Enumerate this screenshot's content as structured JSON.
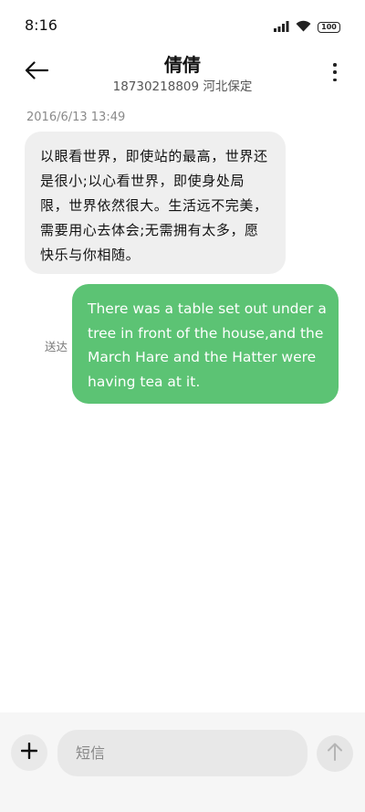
{
  "status_bar": {
    "time": "8:16",
    "battery": "100",
    "icons": [
      "signal-icon",
      "wifi-icon",
      "battery-icon"
    ]
  },
  "header": {
    "contact_name": "倩倩",
    "contact_subtitle": "18730218809 河北保定",
    "icons": [
      "back-arrow-icon",
      "more-options-icon"
    ]
  },
  "conversation": {
    "timestamp": "2016/6/13 13:49",
    "incoming_message": "以眼看世界，即使站的最高，世界还是很小;以心看世界，即使身处局限，世界依然很大。生活远不完美，需要用心去体会;无需拥有太多，愿快乐与你相随。",
    "outgoing_message": "There was a table set out under a tree in front of the house,and the March Hare and the Hatter were having tea at it.",
    "delivery_status": "送达"
  },
  "composer": {
    "placeholder": "短信",
    "value": "",
    "icons": [
      "plus-icon",
      "send-arrow-icon"
    ]
  },
  "colors": {
    "outgoing_bubble": "#5cc374",
    "incoming_bubble": "#efefef",
    "input_bar": "#f6f6f6"
  }
}
